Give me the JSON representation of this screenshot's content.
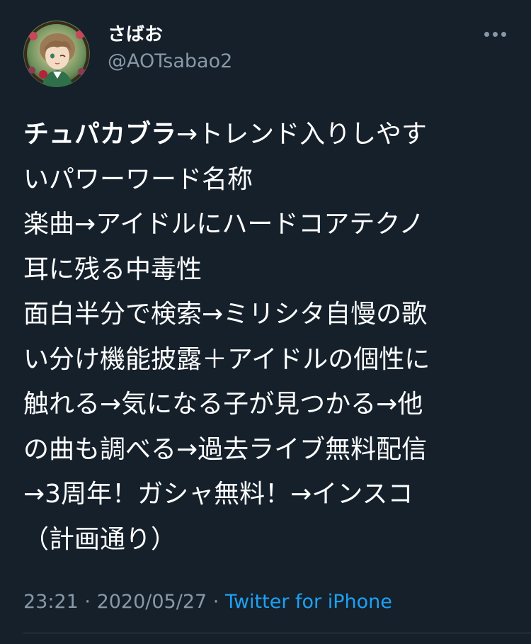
{
  "tweet": {
    "author": {
      "display_name": "さばお",
      "handle": "@AOTsabao2",
      "avatar_icon": "user-avatar-icon"
    },
    "more_icon": "more-dots-icon",
    "text_lines": [
      {
        "bold": "チュパカブラ",
        "rest": "→トレンド入りしやす"
      },
      {
        "bold": "",
        "rest": "いパワーワード名称"
      },
      {
        "bold": "",
        "rest": "楽曲→アイドルにハードコアテクノ"
      },
      {
        "bold": "",
        "rest": "耳に残る中毒性"
      },
      {
        "bold": "",
        "rest": "面白半分で検索→ミリシタ自慢の歌"
      },
      {
        "bold": "",
        "rest": "い分け機能披露＋アイドルの個性に"
      },
      {
        "bold": "",
        "rest": "触れる→気になる子が見つかる→他"
      },
      {
        "bold": "",
        "rest": "の曲も調べる→過去ライブ無料配信"
      },
      {
        "bold": "",
        "rest": "→3周年！ガシャ無料！→インスコ"
      },
      {
        "bold": "",
        "rest": "（計画通り）"
      }
    ],
    "meta": {
      "time": "23:21",
      "separator1": " · ",
      "date": "2020/05/27",
      "separator2": " · ",
      "source": "Twitter for iPhone"
    }
  },
  "colors": {
    "background": "#15202b",
    "text": "#ffffff",
    "secondary": "#8899a6",
    "link": "#1da1f2",
    "divider": "#38444d"
  }
}
